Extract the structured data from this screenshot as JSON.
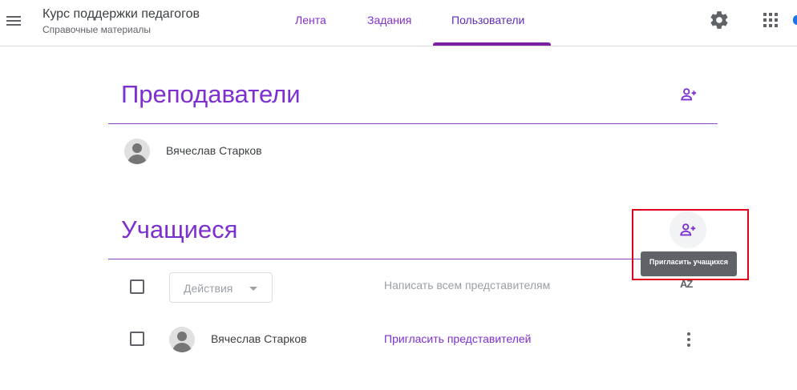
{
  "header": {
    "course_title": "Курс поддержки педагогов",
    "course_subtitle": "Справочные материалы",
    "tabs": [
      {
        "label": "Лента",
        "active": false
      },
      {
        "label": "Задания",
        "active": false
      },
      {
        "label": "Пользователи",
        "active": true
      }
    ],
    "icons": [
      "menu-icon",
      "gear-icon",
      "apps-grid-icon"
    ]
  },
  "teachers": {
    "title": "Преподаватели",
    "members": [
      {
        "name": "Вячеслав Старков"
      }
    ]
  },
  "students": {
    "title": "Учащиеся",
    "actions_label": "Действия",
    "email_all_label": "Написать всем представителям",
    "sort_label": "AZ",
    "members": [
      {
        "name": "Вячеслав Старков",
        "invite_label": "Пригласить представителей"
      }
    ]
  },
  "tooltip": {
    "text": "Пригласить учащихся"
  },
  "colors": {
    "accent": "#7e2fd0",
    "highlight_box": "#e0001b",
    "tooltip_bg": "#5f6368"
  }
}
